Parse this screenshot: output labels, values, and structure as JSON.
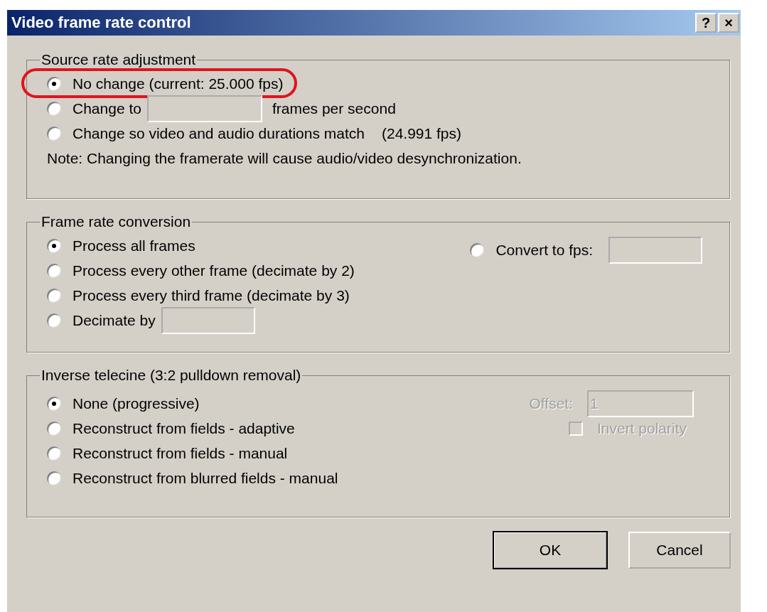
{
  "window": {
    "title": "Video frame rate control",
    "title_buttons": [
      "?",
      "×"
    ]
  },
  "source_rate": {
    "title": "Source rate adjustment",
    "options": [
      {
        "kind": "plain",
        "label": "No change (current: 25.000 fps)",
        "selected": true,
        "circled": true
      },
      {
        "kind": "input",
        "label": "Change to",
        "after": "frames per second",
        "selected": false,
        "circled": false
      },
      {
        "kind": "info",
        "label": "Change so video and audio durations match",
        "after": "(24.991 fps)",
        "selected": false,
        "circled": false
      }
    ],
    "note": "Note: Changing the framerate will cause audio/video desynchronization."
  },
  "frame_rate_conversion": {
    "title": "Frame rate conversion",
    "options": [
      {
        "kind": "plain",
        "label": "Process all frames",
        "selected": true
      },
      {
        "kind": "plain",
        "label": "Process every other frame (decimate by 2)",
        "selected": false
      },
      {
        "kind": "plain",
        "label": "Process every third frame (decimate by 3)",
        "selected": false
      },
      {
        "kind": "input",
        "label": "Decimate by",
        "selected": false
      }
    ],
    "convert": {
      "label": "Convert to fps:",
      "selected": false
    }
  },
  "inverse_telecine": {
    "title": "Inverse telecine (3:2 pulldown removal)",
    "options": [
      {
        "label": "None (progressive)",
        "selected": true
      },
      {
        "label": "Reconstruct from fields - adaptive",
        "selected": false
      },
      {
        "label": "Reconstruct from fields - manual",
        "selected": false
      },
      {
        "label": "Reconstruct from blurred fields - manual",
        "selected": false
      }
    ],
    "offset": {
      "label": "Offset:",
      "value": "1",
      "disabled": true
    },
    "invert_polarity": {
      "label": "Invert polarity",
      "checked": false,
      "disabled": true
    }
  },
  "buttons": [
    {
      "label": "OK",
      "default": true
    },
    {
      "label": "Cancel",
      "default": false
    }
  ]
}
